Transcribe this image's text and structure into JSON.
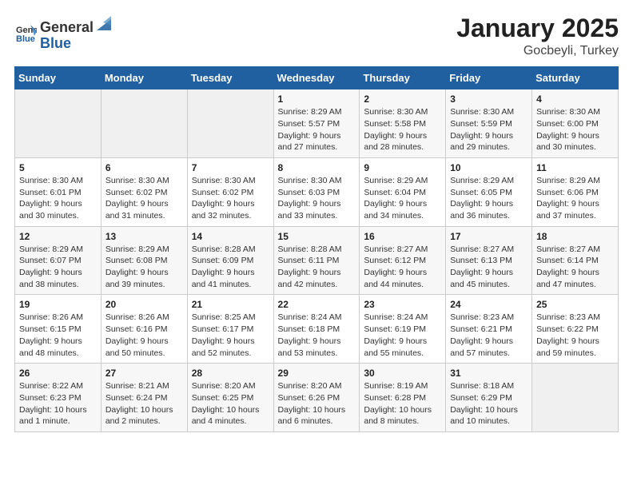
{
  "header": {
    "logo_general": "General",
    "logo_blue": "Blue",
    "month": "January 2025",
    "location": "Gocbeyli, Turkey"
  },
  "days_of_week": [
    "Sunday",
    "Monday",
    "Tuesday",
    "Wednesday",
    "Thursday",
    "Friday",
    "Saturday"
  ],
  "weeks": [
    [
      {
        "day": "",
        "info": ""
      },
      {
        "day": "",
        "info": ""
      },
      {
        "day": "",
        "info": ""
      },
      {
        "day": "1",
        "info": "Sunrise: 8:29 AM\nSunset: 5:57 PM\nDaylight: 9 hours and 27 minutes."
      },
      {
        "day": "2",
        "info": "Sunrise: 8:30 AM\nSunset: 5:58 PM\nDaylight: 9 hours and 28 minutes."
      },
      {
        "day": "3",
        "info": "Sunrise: 8:30 AM\nSunset: 5:59 PM\nDaylight: 9 hours and 29 minutes."
      },
      {
        "day": "4",
        "info": "Sunrise: 8:30 AM\nSunset: 6:00 PM\nDaylight: 9 hours and 30 minutes."
      }
    ],
    [
      {
        "day": "5",
        "info": "Sunrise: 8:30 AM\nSunset: 6:01 PM\nDaylight: 9 hours and 30 minutes."
      },
      {
        "day": "6",
        "info": "Sunrise: 8:30 AM\nSunset: 6:02 PM\nDaylight: 9 hours and 31 minutes."
      },
      {
        "day": "7",
        "info": "Sunrise: 8:30 AM\nSunset: 6:02 PM\nDaylight: 9 hours and 32 minutes."
      },
      {
        "day": "8",
        "info": "Sunrise: 8:30 AM\nSunset: 6:03 PM\nDaylight: 9 hours and 33 minutes."
      },
      {
        "day": "9",
        "info": "Sunrise: 8:29 AM\nSunset: 6:04 PM\nDaylight: 9 hours and 34 minutes."
      },
      {
        "day": "10",
        "info": "Sunrise: 8:29 AM\nSunset: 6:05 PM\nDaylight: 9 hours and 36 minutes."
      },
      {
        "day": "11",
        "info": "Sunrise: 8:29 AM\nSunset: 6:06 PM\nDaylight: 9 hours and 37 minutes."
      }
    ],
    [
      {
        "day": "12",
        "info": "Sunrise: 8:29 AM\nSunset: 6:07 PM\nDaylight: 9 hours and 38 minutes."
      },
      {
        "day": "13",
        "info": "Sunrise: 8:29 AM\nSunset: 6:08 PM\nDaylight: 9 hours and 39 minutes."
      },
      {
        "day": "14",
        "info": "Sunrise: 8:28 AM\nSunset: 6:09 PM\nDaylight: 9 hours and 41 minutes."
      },
      {
        "day": "15",
        "info": "Sunrise: 8:28 AM\nSunset: 6:11 PM\nDaylight: 9 hours and 42 minutes."
      },
      {
        "day": "16",
        "info": "Sunrise: 8:27 AM\nSunset: 6:12 PM\nDaylight: 9 hours and 44 minutes."
      },
      {
        "day": "17",
        "info": "Sunrise: 8:27 AM\nSunset: 6:13 PM\nDaylight: 9 hours and 45 minutes."
      },
      {
        "day": "18",
        "info": "Sunrise: 8:27 AM\nSunset: 6:14 PM\nDaylight: 9 hours and 47 minutes."
      }
    ],
    [
      {
        "day": "19",
        "info": "Sunrise: 8:26 AM\nSunset: 6:15 PM\nDaylight: 9 hours and 48 minutes."
      },
      {
        "day": "20",
        "info": "Sunrise: 8:26 AM\nSunset: 6:16 PM\nDaylight: 9 hours and 50 minutes."
      },
      {
        "day": "21",
        "info": "Sunrise: 8:25 AM\nSunset: 6:17 PM\nDaylight: 9 hours and 52 minutes."
      },
      {
        "day": "22",
        "info": "Sunrise: 8:24 AM\nSunset: 6:18 PM\nDaylight: 9 hours and 53 minutes."
      },
      {
        "day": "23",
        "info": "Sunrise: 8:24 AM\nSunset: 6:19 PM\nDaylight: 9 hours and 55 minutes."
      },
      {
        "day": "24",
        "info": "Sunrise: 8:23 AM\nSunset: 6:21 PM\nDaylight: 9 hours and 57 minutes."
      },
      {
        "day": "25",
        "info": "Sunrise: 8:23 AM\nSunset: 6:22 PM\nDaylight: 9 hours and 59 minutes."
      }
    ],
    [
      {
        "day": "26",
        "info": "Sunrise: 8:22 AM\nSunset: 6:23 PM\nDaylight: 10 hours and 1 minute."
      },
      {
        "day": "27",
        "info": "Sunrise: 8:21 AM\nSunset: 6:24 PM\nDaylight: 10 hours and 2 minutes."
      },
      {
        "day": "28",
        "info": "Sunrise: 8:20 AM\nSunset: 6:25 PM\nDaylight: 10 hours and 4 minutes."
      },
      {
        "day": "29",
        "info": "Sunrise: 8:20 AM\nSunset: 6:26 PM\nDaylight: 10 hours and 6 minutes."
      },
      {
        "day": "30",
        "info": "Sunrise: 8:19 AM\nSunset: 6:28 PM\nDaylight: 10 hours and 8 minutes."
      },
      {
        "day": "31",
        "info": "Sunrise: 8:18 AM\nSunset: 6:29 PM\nDaylight: 10 hours and 10 minutes."
      },
      {
        "day": "",
        "info": ""
      }
    ]
  ]
}
